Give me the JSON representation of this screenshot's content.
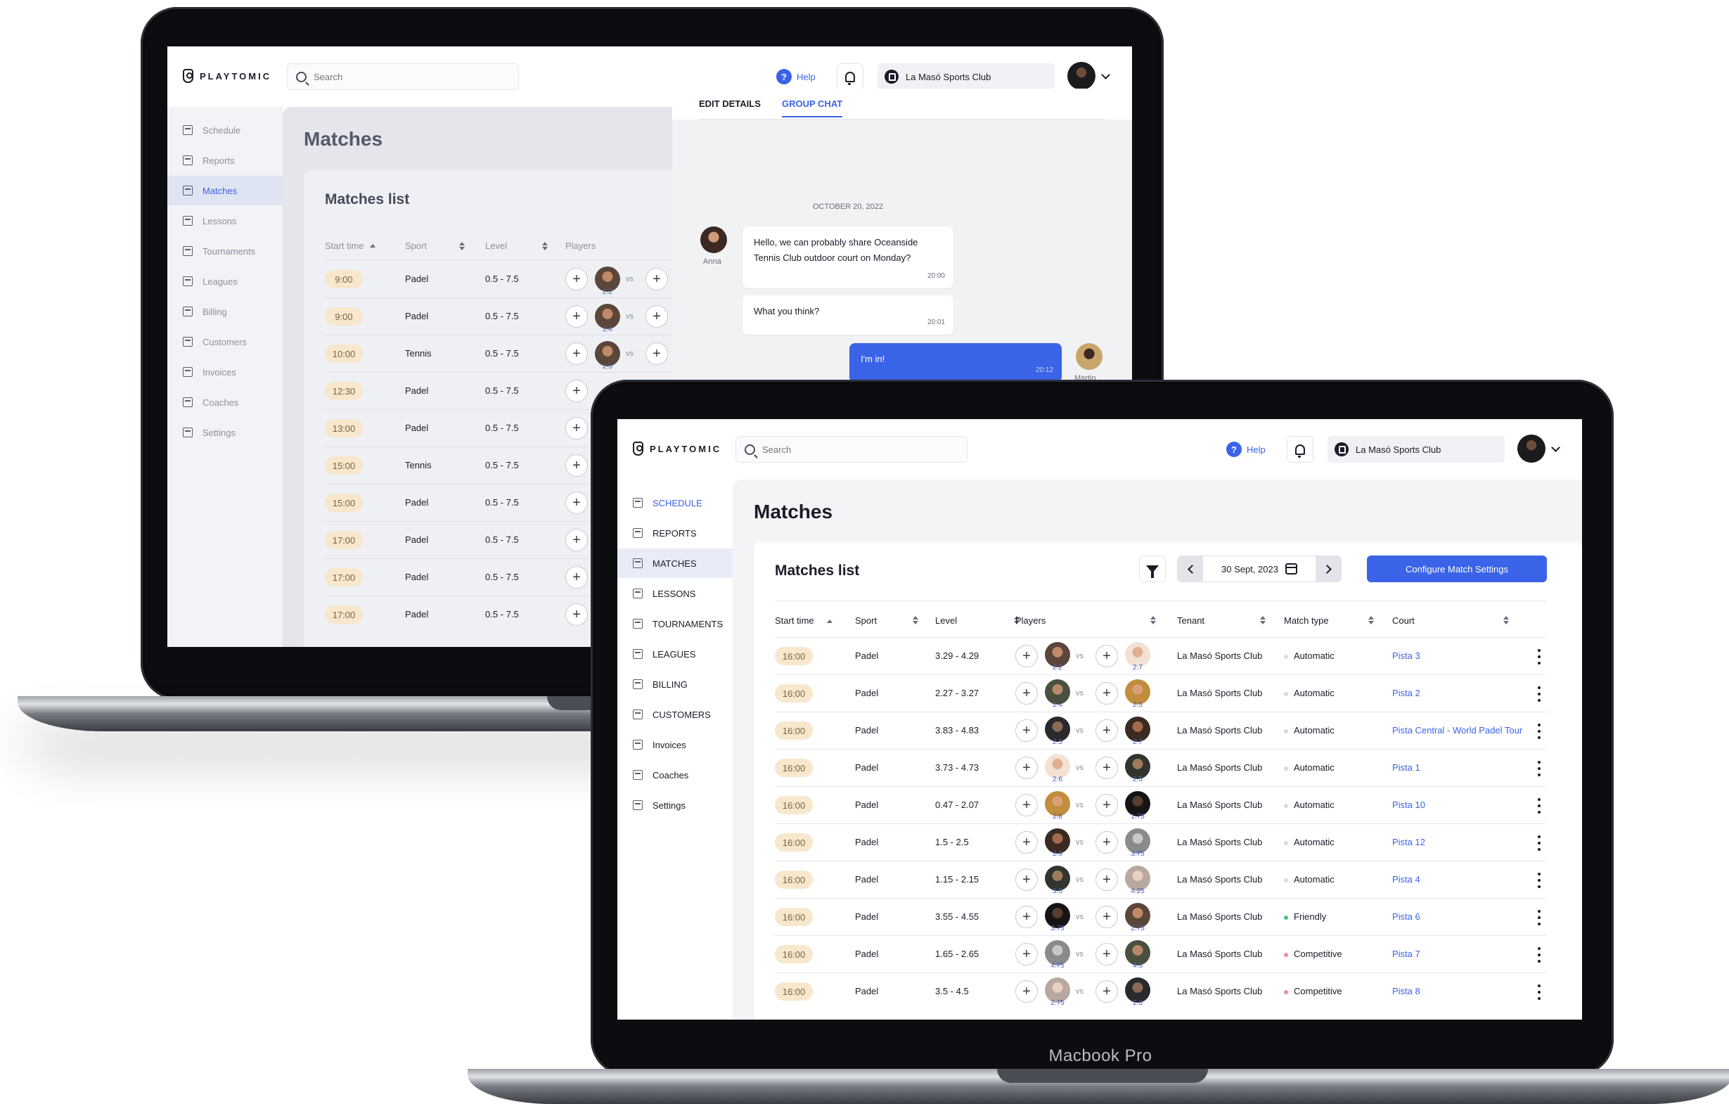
{
  "app": {
    "logo": "PLAYTOMIC",
    "search_placeholder": "Search",
    "help": "Help",
    "club": "La Masó Sports Club",
    "device_label": "Macbook Pro"
  },
  "back_screen": {
    "nav": [
      "Schedule",
      "Reports",
      "Matches",
      "Lessons",
      "Tournaments",
      "Leagues",
      "Billing",
      "Customers",
      "Invoices",
      "Coaches",
      "Settings"
    ],
    "active_nav": "Matches",
    "page_title": "Matches",
    "card_title": "Matches list",
    "headers": [
      "Start time",
      "Sport",
      "Level",
      "Players"
    ],
    "rows": [
      {
        "time": "9:00",
        "sport": "Padel",
        "level": "0.5 - 7.5",
        "player_level": "2.2"
      },
      {
        "time": "9:00",
        "sport": "Padel",
        "level": "0.5 - 7.5",
        "player_level": "2.4"
      },
      {
        "time": "10:00",
        "sport": "Tennis",
        "level": "0.5 - 7.5",
        "player_level": "2.5"
      },
      {
        "time": "12:30",
        "sport": "Padel",
        "level": "0.5 - 7.5",
        "player_level": ""
      },
      {
        "time": "13:00",
        "sport": "Padel",
        "level": "0.5 - 7.5",
        "player_level": ""
      },
      {
        "time": "15:00",
        "sport": "Tennis",
        "level": "0.5 - 7.5",
        "player_level": ""
      },
      {
        "time": "15:00",
        "sport": "Padel",
        "level": "0.5 - 7.5",
        "player_level": ""
      },
      {
        "time": "17:00",
        "sport": "Padel",
        "level": "0.5 - 7.5",
        "player_level": ""
      },
      {
        "time": "17:00",
        "sport": "Padel",
        "level": "0.5 - 7.5",
        "player_level": ""
      },
      {
        "time": "17:00",
        "sport": "Padel",
        "level": "0.5 - 7.5",
        "player_level": ""
      }
    ],
    "vs": "vs",
    "chat": {
      "tabs": [
        "EDIT DETAILS",
        "GROUP CHAT"
      ],
      "active_tab": "GROUP CHAT",
      "date": "OCTOBER 20, 2022",
      "messages": [
        {
          "author": "Anna",
          "text": "Hello, we can probably share Oceanside Tennis Club outdoor court on Monday?",
          "time": "20:00"
        },
        {
          "author": "",
          "text": "What you think?",
          "time": "20:01"
        },
        {
          "author": "Martin",
          "text": "I'm in!",
          "time": "20:12"
        }
      ]
    }
  },
  "front_screen": {
    "nav": [
      "SCHEDULE",
      "REPORTS",
      "MATCHES",
      "LESSONS",
      "TOURNAMENTS",
      "LEAGUES",
      "BILLING",
      "CUSTOMERS",
      "Invoices",
      "Coaches",
      "Settings"
    ],
    "active_nav": "MATCHES",
    "highlight_nav": "SCHEDULE",
    "page_title": "Matches",
    "card_title": "Matches list",
    "date": "30 Sept, 2023",
    "configure_button": "Configure Match Settings",
    "headers": [
      "Start time",
      "Sport",
      "Level",
      "Players",
      "Tenant",
      "Match type",
      "Court"
    ],
    "vs": "vs",
    "rows": [
      {
        "time": "16:00",
        "sport": "Padel",
        "level": "3.29 - 4.29",
        "p1": "2.2",
        "p2": "2.7",
        "tenant": "La Masó Sports Club",
        "match_type": "Automatic",
        "court": "Pista 3"
      },
      {
        "time": "16:00",
        "sport": "Padel",
        "level": "2.27 - 3.27",
        "p1": "2.4",
        "p2": "2.5",
        "tenant": "La Masó Sports Club",
        "match_type": "Automatic",
        "court": "Pista 2"
      },
      {
        "time": "16:00",
        "sport": "Padel",
        "level": "3.83 - 4.83",
        "p1": "2.5",
        "p2": "2.7",
        "tenant": "La Masó Sports Club",
        "match_type": "Automatic",
        "court": "Pista Central - World Padel Tour"
      },
      {
        "time": "16:00",
        "sport": "Padel",
        "level": "3.73 - 4.73",
        "p1": "2.6",
        "p2": "2.5",
        "tenant": "La Masó Sports Club",
        "match_type": "Automatic",
        "court": "Pista 1"
      },
      {
        "time": "16:00",
        "sport": "Padel",
        "level": "0.47 - 2.07",
        "p1": "2.8",
        "p2": "1.75",
        "tenant": "La Masó Sports Club",
        "match_type": "Automatic",
        "court": "Pista 10"
      },
      {
        "time": "16:00",
        "sport": "Padel",
        "level": "1.5 - 2.5",
        "p1": "2.9",
        "p2": "3.75",
        "tenant": "La Masó Sports Club",
        "match_type": "Automatic",
        "court": "Pista 12"
      },
      {
        "time": "16:00",
        "sport": "Padel",
        "level": "1.15 - 2.15",
        "p1": "3.0",
        "p2": "4.25",
        "tenant": "La Masó Sports Club",
        "match_type": "Automatic",
        "court": "Pista 4"
      },
      {
        "time": "16:00",
        "sport": "Padel",
        "level": "3.55 - 4.55",
        "p1": "3.75",
        "p2": "2.75",
        "tenant": "La Masó Sports Club",
        "match_type": "Friendly",
        "court": "Pista 6"
      },
      {
        "time": "16:00",
        "sport": "Padel",
        "level": "1.65 - 2.65",
        "p1": "4.75",
        "p2": "4.3",
        "tenant": "La Masó Sports Club",
        "match_type": "Competitive",
        "court": "Pista 7"
      },
      {
        "time": "16:00",
        "sport": "Padel",
        "level": "3.5 - 4.5",
        "p1": "2.75",
        "p2": "2.3",
        "tenant": "La Masó Sports Club",
        "match_type": "Competitive",
        "court": "Pista 8"
      }
    ]
  },
  "colors": {
    "accent": "#3b63e8",
    "time_pill": "#f7e7cc",
    "automatic": "#d8dae2",
    "friendly": "#4cbf7a",
    "competitive": "#f08aa0"
  }
}
